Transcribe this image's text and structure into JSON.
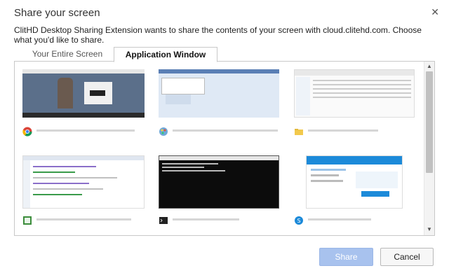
{
  "dialog": {
    "title": "Share your screen",
    "close_glyph": "✕",
    "description": "ClitHD Desktop Sharing Extension wants to share the contents of your screen with cloud.clitehd.com. Choose what you'd like to share."
  },
  "tabs": [
    {
      "label": "Your Entire Screen",
      "active": false
    },
    {
      "label": "Application Window",
      "active": true
    }
  ],
  "windows": [
    {
      "icon": "chrome-icon",
      "title_visible": "▯ ...",
      "blurred": true
    },
    {
      "icon": "paint-app-icon",
      "title_visible": "",
      "blurred": true
    },
    {
      "icon": "folder-icon",
      "title_visible": "",
      "blurred": true
    },
    {
      "icon": "editor-app-icon",
      "title_visible": "",
      "blurred": true
    },
    {
      "icon": "terminal-icon",
      "title_visible": "",
      "blurred": true
    },
    {
      "icon": "skype-app-icon",
      "title_visible": "",
      "blurred": true
    }
  ],
  "buttons": {
    "share": "Share",
    "cancel": "Cancel"
  },
  "colors": {
    "share_button_bg": "#a8c2ee",
    "accent_blue": "#1c8ad9"
  }
}
